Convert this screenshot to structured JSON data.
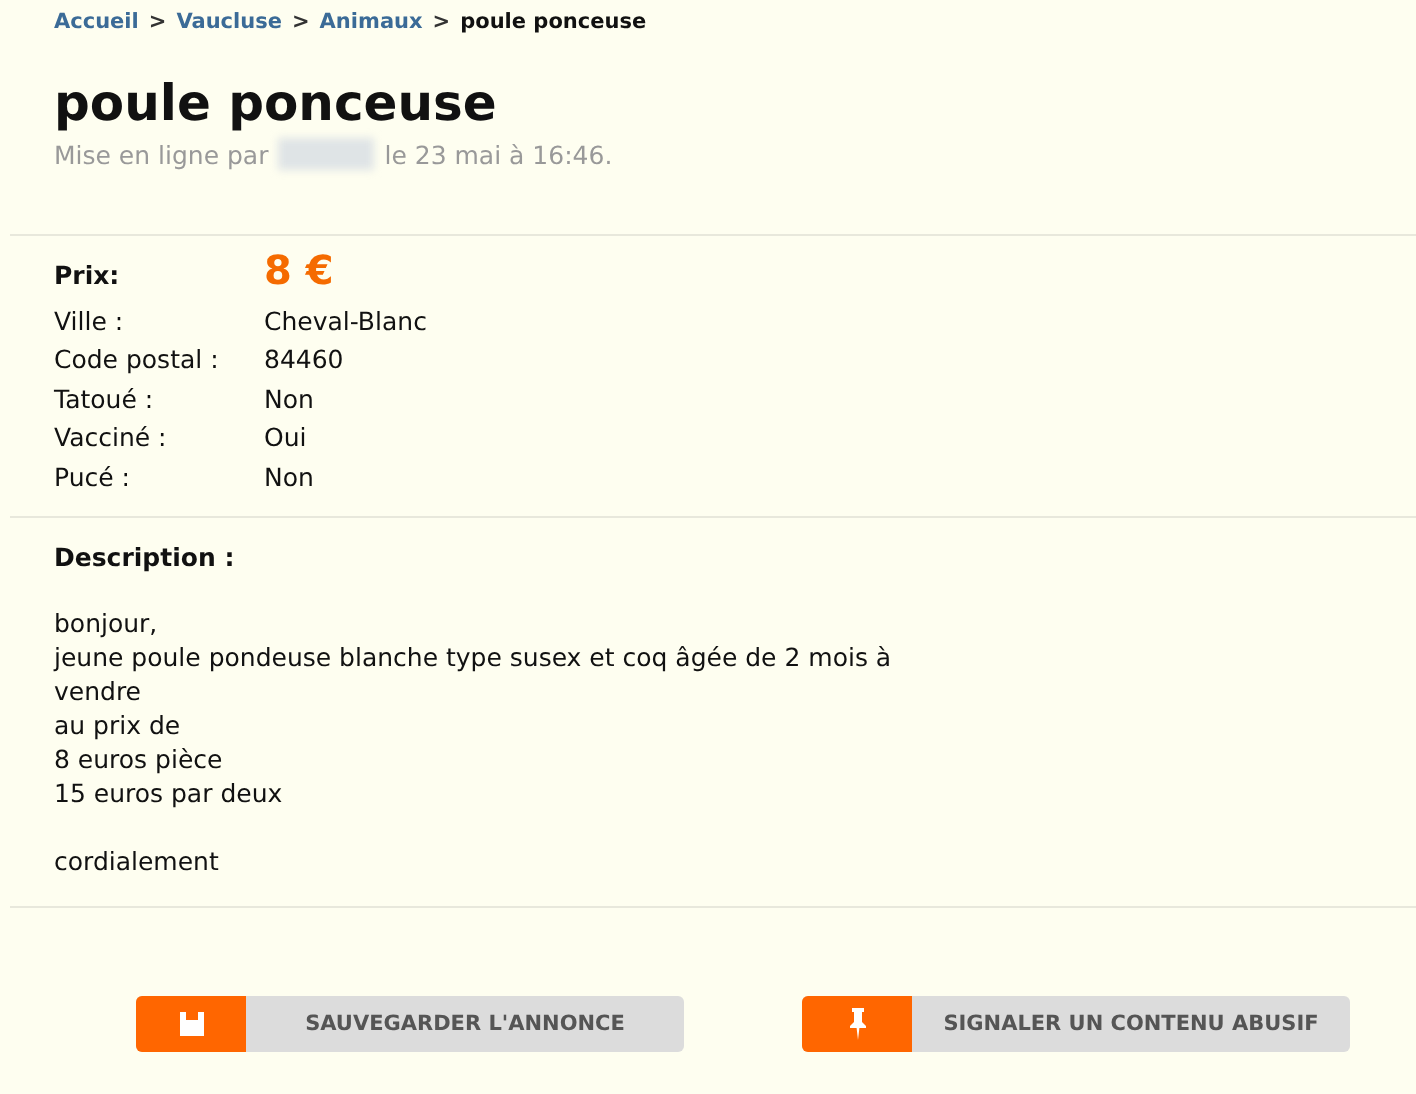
{
  "breadcrumb": [
    {
      "label": "Accueil",
      "current": false
    },
    {
      "label": "Vaucluse",
      "current": false
    },
    {
      "label": "Animaux",
      "current": false
    },
    {
      "label": "poule ponceuse",
      "current": true
    }
  ],
  "breadcrumb_separator": ">",
  "title": "poule ponceuse",
  "posted": {
    "prefix": "Mise en ligne par",
    "suffix": "le 23 mai à 16:46."
  },
  "price": {
    "label": "Prix:",
    "value": "8 €"
  },
  "details": [
    {
      "label": "Ville :",
      "value": "Cheval-Blanc"
    },
    {
      "label": "Code postal :",
      "value": "84460"
    },
    {
      "label": "Tatoué :",
      "value": "Non"
    },
    {
      "label": "Vacciné :",
      "value": "Oui"
    },
    {
      "label": "Pucé :",
      "value": "Non"
    }
  ],
  "description": {
    "label": "Description :",
    "paragraphs": [
      "bonjour,\njeune poule pondeuse blanche type susex et coq âgée de 2 mois à\nvendre\nau prix de\n8 euros pièce\n15 euros par deux",
      "cordialement"
    ]
  },
  "buttons": [
    {
      "kind": "save",
      "label": "SAUVEGARDER L'ANNONCE"
    },
    {
      "kind": "report",
      "label": "SIGNALER UN CONTENU ABUSIF"
    }
  ]
}
